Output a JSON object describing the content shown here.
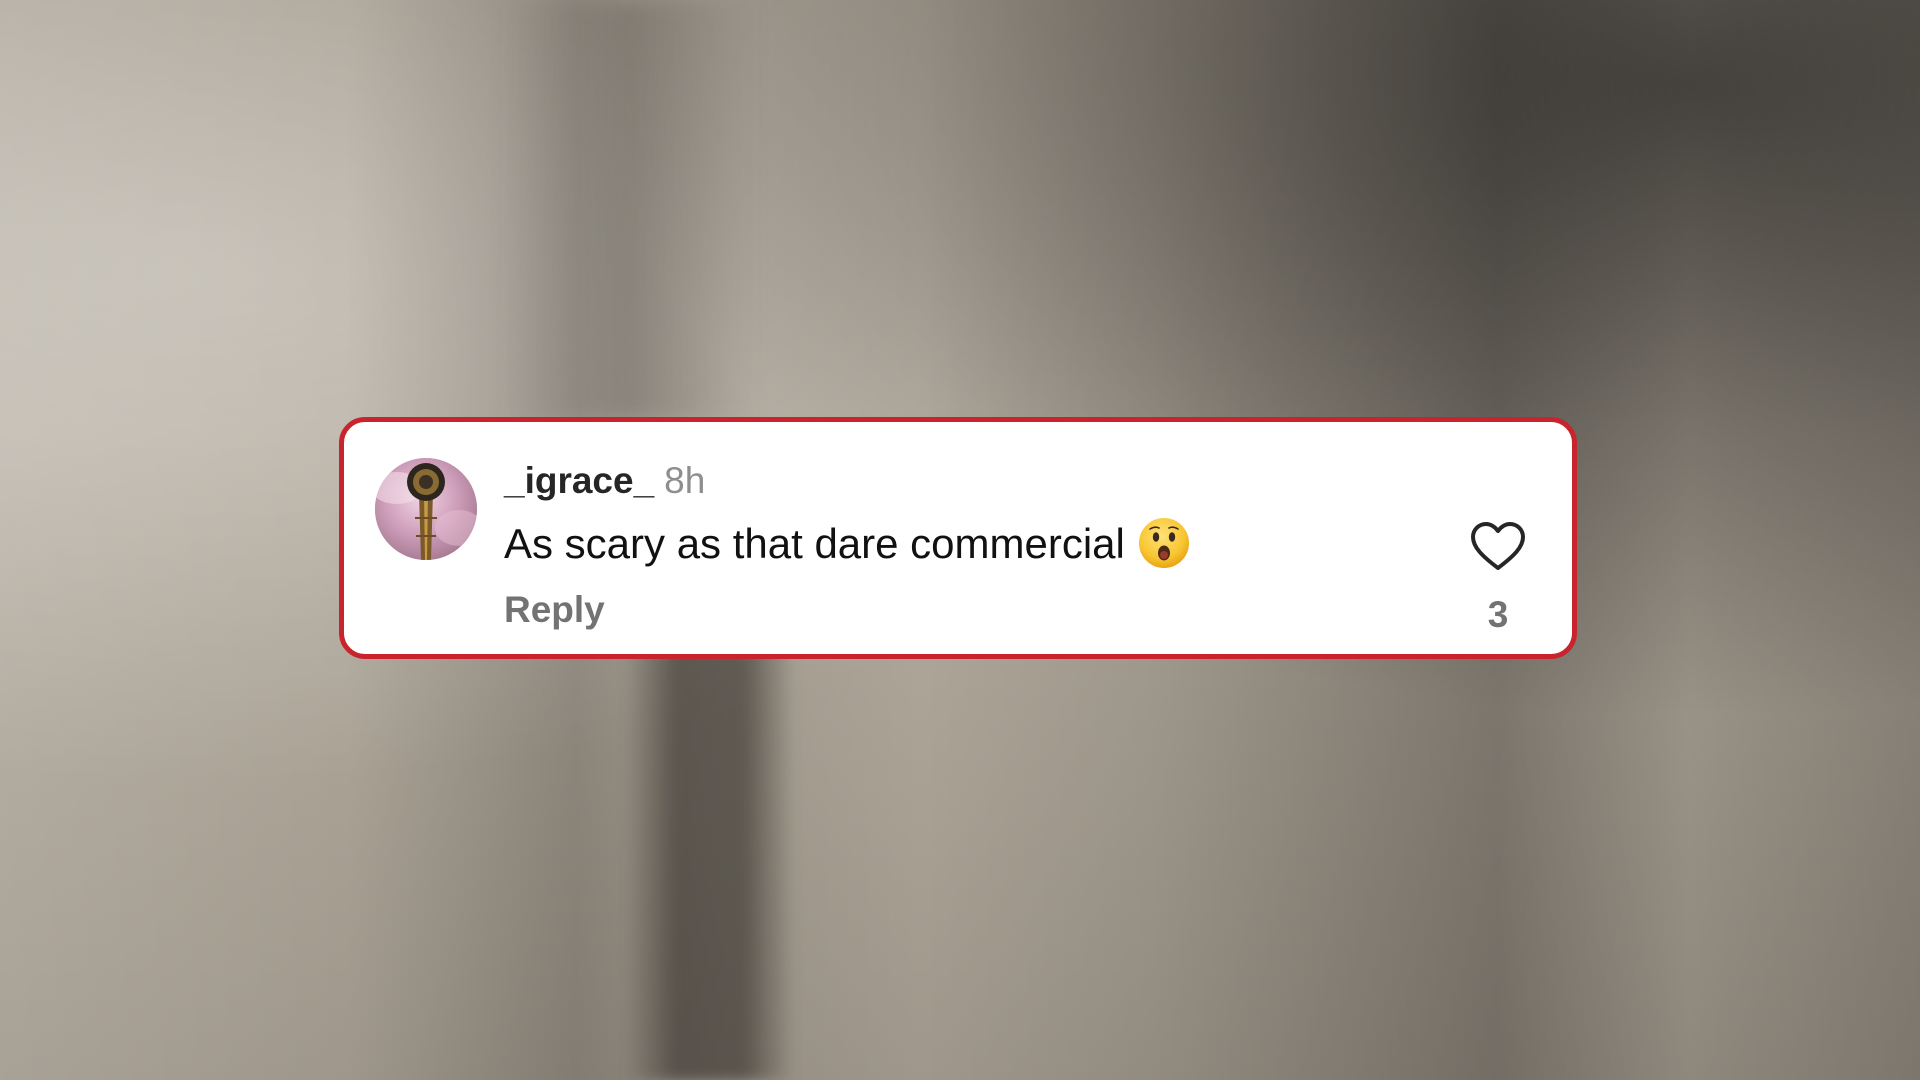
{
  "comment": {
    "username": "_igrace_",
    "timestamp": "8h",
    "text": "As scary as that dare commercial",
    "emoji": "hushed-face-emoji",
    "reply_label": "Reply",
    "like_count": "3",
    "liked": false
  },
  "colors": {
    "card_border": "#c8242e",
    "card_background": "#ffffff",
    "username": "#262626",
    "meta_text": "#8e8e8e",
    "reply_text": "#737373"
  },
  "icons": {
    "like": "heart-outline-icon",
    "avatar": "user-avatar-image"
  }
}
